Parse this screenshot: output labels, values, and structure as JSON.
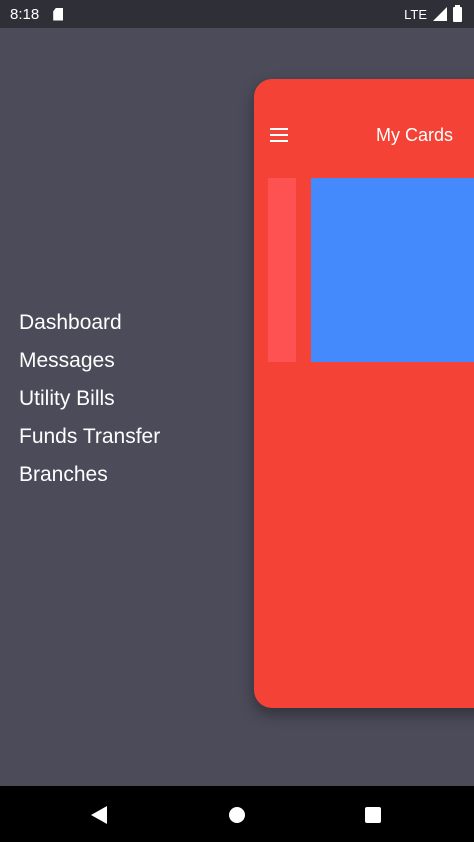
{
  "status_bar": {
    "time": "8:18",
    "network": "LTE",
    "icons": [
      "sd-card-icon",
      "signal-icon",
      "battery-icon"
    ]
  },
  "drawer": {
    "items": [
      {
        "label": "Dashboard"
      },
      {
        "label": "Messages"
      },
      {
        "label": "Utility Bills"
      },
      {
        "label": "Funds Transfer"
      },
      {
        "label": "Branches"
      }
    ]
  },
  "main_panel": {
    "title": "My Cards",
    "menu_icon": "hamburger-menu-icon",
    "cards": [
      {
        "color": "#fe5151"
      },
      {
        "color": "#448afc"
      }
    ]
  },
  "nav_bar": {
    "icons": [
      "back-icon",
      "home-icon",
      "recents-icon"
    ]
  },
  "colors": {
    "background": "#4b4b59",
    "panel": "#f44336",
    "status_bar": "#2f2f37",
    "nav_bar": "#000000"
  }
}
